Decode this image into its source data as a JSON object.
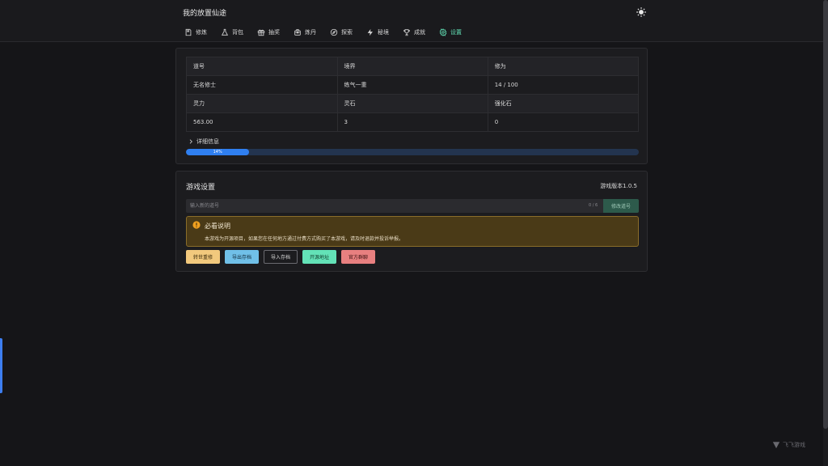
{
  "header": {
    "title": "我的放置仙途",
    "nav": [
      {
        "label": "修炼",
        "icon": "book-icon"
      },
      {
        "label": "背包",
        "icon": "flask-icon"
      },
      {
        "label": "抽奖",
        "icon": "gift-icon"
      },
      {
        "label": "炼丹",
        "icon": "furnace-icon"
      },
      {
        "label": "探索",
        "icon": "compass-icon"
      },
      {
        "label": "秘境",
        "icon": "lightning-icon"
      },
      {
        "label": "成就",
        "icon": "trophy-icon"
      },
      {
        "label": "设置",
        "icon": "gear-icon",
        "active": true
      }
    ]
  },
  "stats": {
    "row1_headers": [
      "道号",
      "境界",
      "修为"
    ],
    "row1_values": [
      "无名修士",
      "练气一重",
      "14 / 100"
    ],
    "row2_headers": [
      "灵力",
      "灵石",
      "强化石"
    ],
    "row2_values": [
      "563.00",
      "3",
      "0"
    ],
    "details_label": "详细信息",
    "progress_percent": 14,
    "progress_label": "14%"
  },
  "settings": {
    "title": "游戏设置",
    "version": "游戏版本1.0.5",
    "name_placeholder": "输入新的道号",
    "name_count": "0 / 6",
    "rename_label": "修改道号",
    "notice_title": "必看说明",
    "notice_text": "本游戏为开源项目，如果您在任何地方通过付费方式购买了本游戏，请及时退款并投诉举报。",
    "buttons": [
      "转世重修",
      "导出存档",
      "导入存档",
      "开源地址",
      "官方群聊"
    ]
  },
  "watermark": "飞飞游戏",
  "colors": {
    "accent": "#63e2b7",
    "progress": "#2f7ff0",
    "warning": "#f2c97d",
    "info": "#70c0e8",
    "error": "#e88080"
  }
}
